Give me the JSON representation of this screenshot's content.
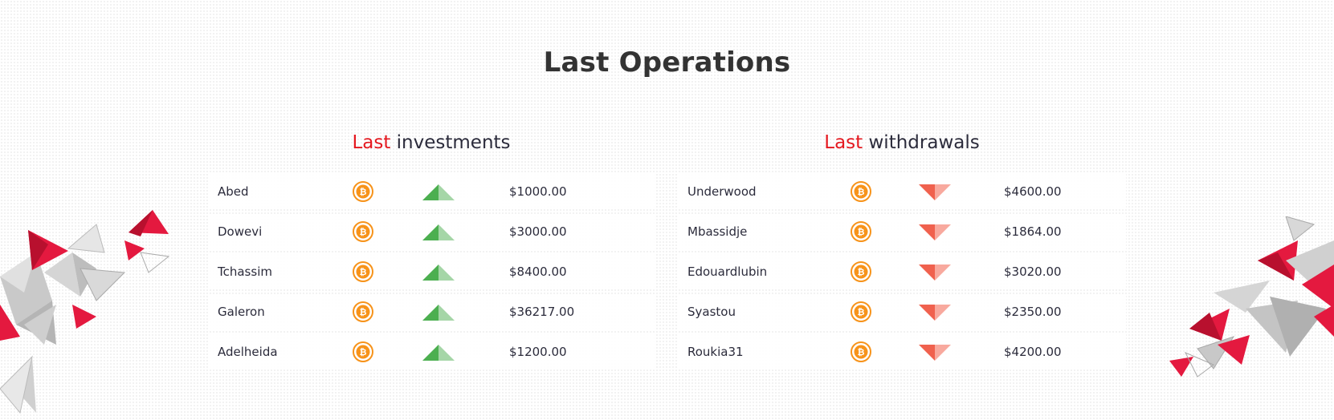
{
  "page": {
    "title": "Last Operations"
  },
  "investments": {
    "heading_accent": "Last",
    "heading_rest": "investments",
    "rows": [
      {
        "name": "Abed",
        "icon": "bitcoin-icon",
        "trend": "up-arrow-icon",
        "amount": "$1000.00"
      },
      {
        "name": "Dowevi",
        "icon": "bitcoin-icon",
        "trend": "up-arrow-icon",
        "amount": "$3000.00"
      },
      {
        "name": "Tchassim",
        "icon": "bitcoin-icon",
        "trend": "up-arrow-icon",
        "amount": "$8400.00"
      },
      {
        "name": "Galeron",
        "icon": "bitcoin-icon",
        "trend": "up-arrow-icon",
        "amount": "$36217.00"
      },
      {
        "name": "Adelheida",
        "icon": "bitcoin-icon",
        "trend": "up-arrow-icon",
        "amount": "$1200.00"
      }
    ]
  },
  "withdrawals": {
    "heading_accent": "Last",
    "heading_rest": "withdrawals",
    "rows": [
      {
        "name": "Underwood",
        "icon": "bitcoin-icon",
        "trend": "down-arrow-icon",
        "amount": "$4600.00"
      },
      {
        "name": "Mbassidje",
        "icon": "bitcoin-icon",
        "trend": "down-arrow-icon",
        "amount": "$1864.00"
      },
      {
        "name": "Edouardlubin",
        "icon": "bitcoin-icon",
        "trend": "down-arrow-icon",
        "amount": "$3020.00"
      },
      {
        "name": "Syastou",
        "icon": "bitcoin-icon",
        "trend": "down-arrow-icon",
        "amount": "$2350.00"
      },
      {
        "name": "Roukia31",
        "icon": "bitcoin-icon",
        "trend": "down-arrow-icon",
        "amount": "$4200.00"
      }
    ]
  },
  "colors": {
    "accent": "#e4181f",
    "text": "#2b2b3b",
    "bitcoin": "#f7931a",
    "up_arrow": "#5cb85c",
    "down_arrow": "#f0614e"
  }
}
